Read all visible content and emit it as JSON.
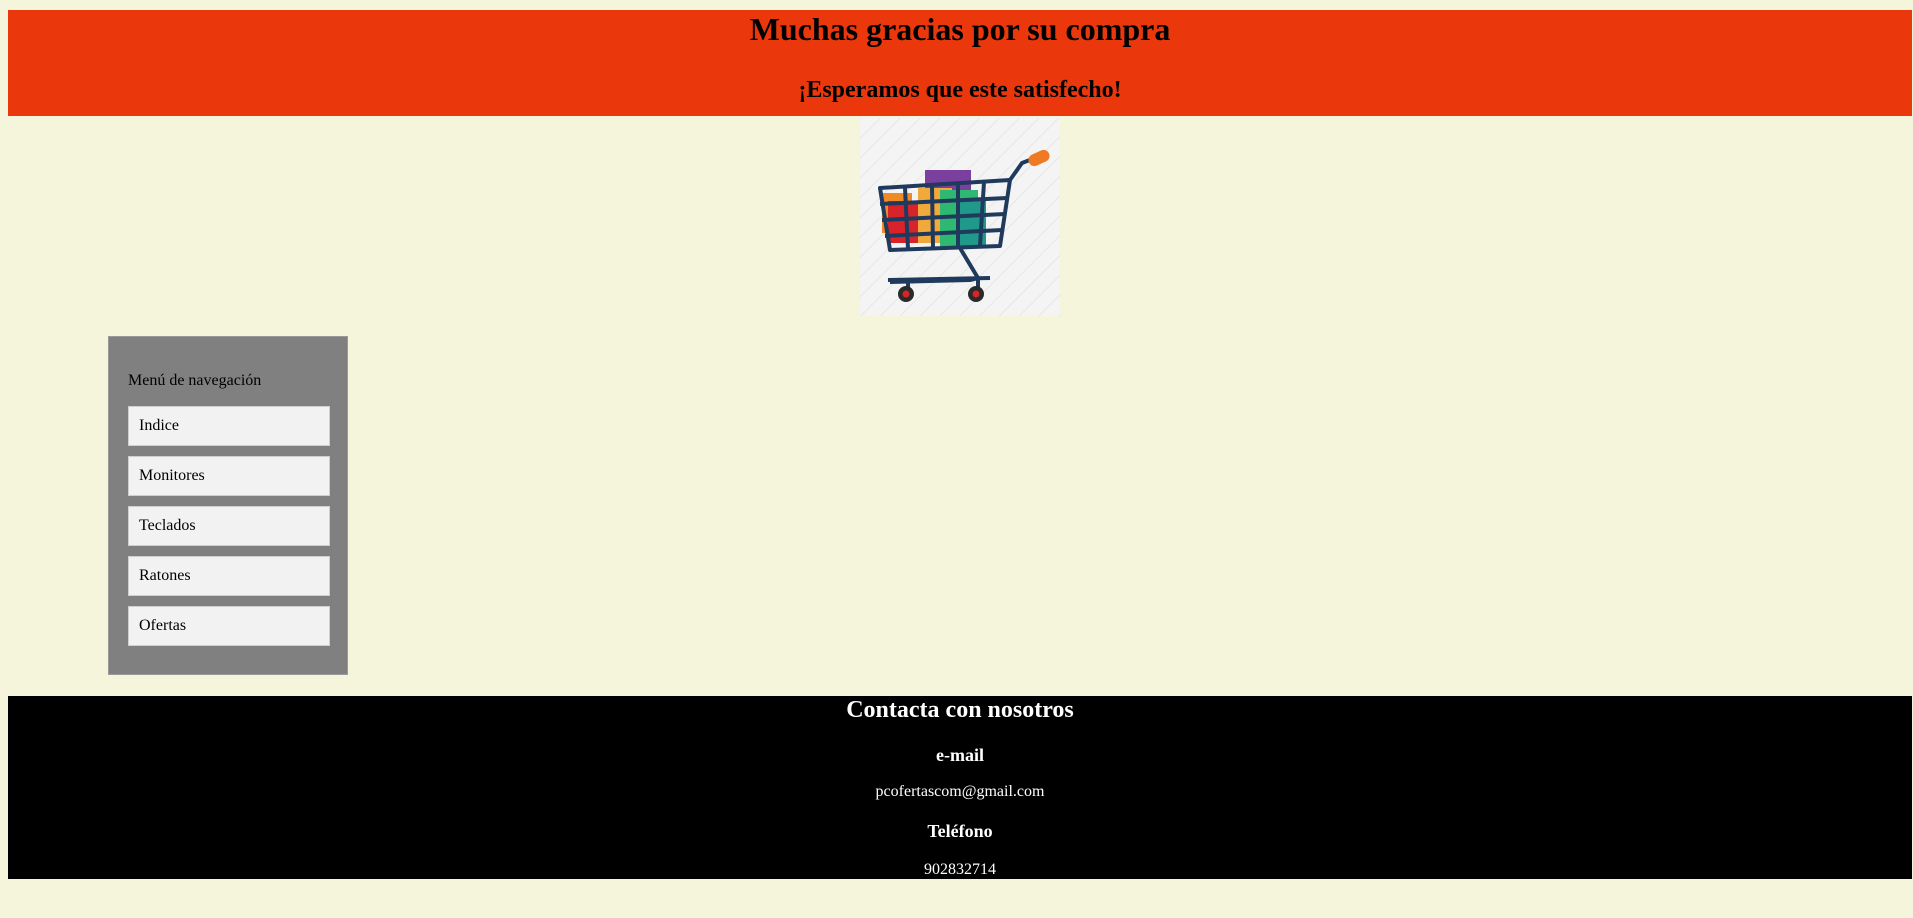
{
  "header": {
    "title": "Muchas gracias por su compra",
    "subtitle": "¡Esperamos que este satisfecho!"
  },
  "image": {
    "icon": "shopping-cart-icon"
  },
  "nav": {
    "title": "Menú de navegación",
    "items": [
      {
        "label": "Indice"
      },
      {
        "label": "Monitores"
      },
      {
        "label": "Teclados"
      },
      {
        "label": "Ratones"
      },
      {
        "label": "Ofertas"
      }
    ]
  },
  "footer": {
    "title": "Contacta con nosotros",
    "email_heading": "e-mail",
    "email": "pcofertascom@gmail.com",
    "phone_heading": "Teléfono",
    "phone": "902832714"
  },
  "colors": {
    "page_background": "#f5f5dc",
    "header_background": "#ea380c",
    "nav_background": "#808080",
    "nav_item_background": "#f2f2f2",
    "footer_background": "#000000"
  }
}
